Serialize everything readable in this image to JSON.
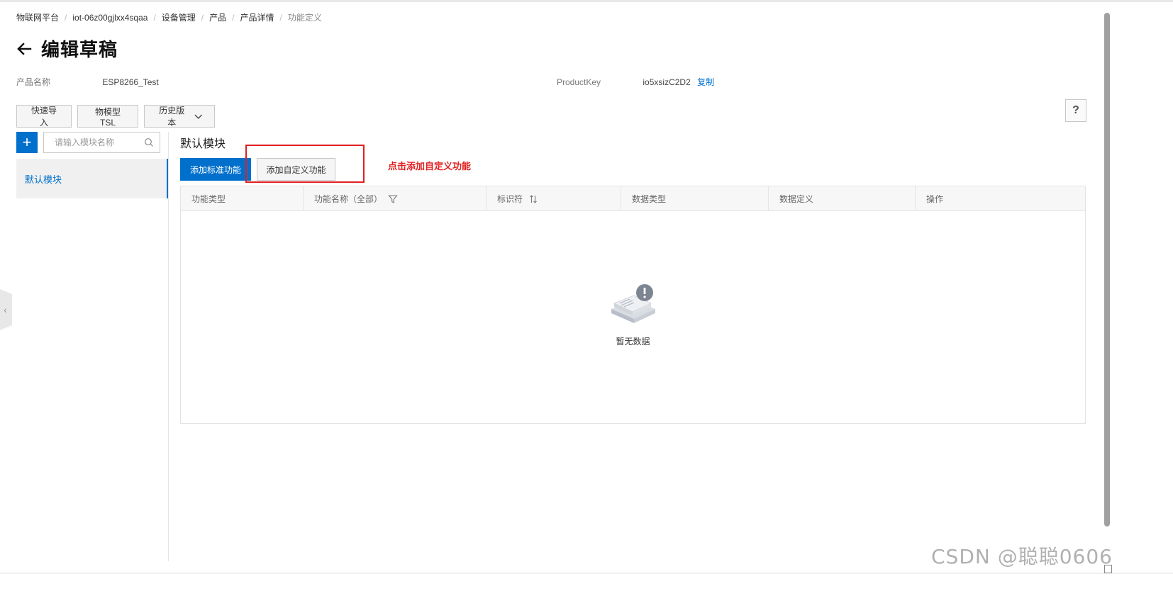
{
  "breadcrumb": [
    "物联网平台",
    "iot-06z00gjlxx4sqaa",
    "设备管理",
    "产品",
    "产品详情",
    "功能定义"
  ],
  "header": {
    "title": "编辑草稿"
  },
  "product": {
    "name_label": "产品名称",
    "name_value": "ESP8266_Test",
    "key_label": "ProductKey",
    "key_value": "io5xsizC2D2",
    "copy_label": "复制"
  },
  "toolbar": {
    "quick_import": "快速导入",
    "tsl_model": "物模型 TSL",
    "history_version": "历史版本"
  },
  "help": {
    "label": "?"
  },
  "sidebar": {
    "add_icon": "+",
    "search_placeholder": "请输入模块名称",
    "modules": [
      {
        "label": "默认模块"
      }
    ]
  },
  "main": {
    "module_title": "默认模块",
    "add_standard": "添加标准功能",
    "add_custom": "添加自定义功能",
    "annotation": "点击添加自定义功能",
    "table": {
      "columns": [
        "功能类型",
        "功能名称（全部）",
        "标识符",
        "数据类型",
        "数据定义",
        "操作"
      ],
      "empty_text": "暂无数据"
    }
  },
  "watermark": "CSDN @聪聪0606",
  "colors": {
    "accent": "#0070cc",
    "annotation": "#e02020"
  }
}
